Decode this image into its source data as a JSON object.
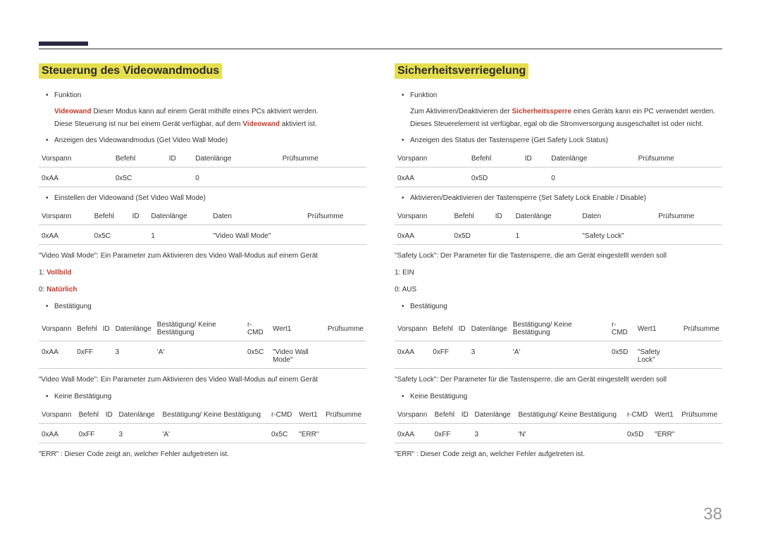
{
  "left": {
    "heading": "Steuerung des Videowandmodus",
    "bullet_funktion": "Funktion",
    "func_line1_pre": "Videowand",
    "func_line1_post": " Dieser Modus kann auf einem Gerät mithilfe eines PCs aktiviert werden.",
    "func_line2_pre": "Diese Steuerung ist nur bei einem Gerät verfügbar, auf dem ",
    "func_line2_red": "Videowand",
    "func_line2_post": " aktiviert ist.",
    "bullet_get": "Anzeigen des Videowandmodus (Get Video Wall Mode)",
    "hdr_vorspann": "Vorspann",
    "hdr_befehl": "Befehl",
    "hdr_id": "ID",
    "hdr_dlen": "Datenlänge",
    "hdr_daten": "Daten",
    "hdr_prufsumme": "Prüfsumme",
    "hdr_best": "Bestätigung/ Keine Bestätigung",
    "hdr_rcmd": "r-CMD",
    "hdr_wert1": "Wert1",
    "r_aa": "0xAA",
    "r_5c": "0x5C",
    "r_0": "0",
    "r_1": "1",
    "r_vwm": "\"Video Wall Mode\"",
    "bullet_set": "Einstellen der Videowand (Set Video Wall Mode)",
    "note_vwm": "\"Video Wall Mode\": Ein Parameter zum Aktivieren des Video Wall-Modus auf einem Gerät",
    "v1_pre": "1: ",
    "v1_red": "Vollbild",
    "v0_pre": "0: ",
    "v0_red": "Natürlich",
    "bullet_best": "Bestätigung",
    "r_ff": "0xFF",
    "r_3": "3",
    "r_a": "'A'",
    "r_n": "'N'",
    "r_vwm2": "\"Video Wall Mode\"",
    "bullet_nobest": "Keine Bestätigung",
    "r_err": "\"ERR\"",
    "note_err": "\"ERR\" : Dieser Code zeigt an, welcher Fehler aufgetreten ist."
  },
  "right": {
    "heading": "Sicherheitsverriegelung",
    "bullet_funktion": "Funktion",
    "func_line1_pre": "Zum Aktivieren/Deaktivieren der ",
    "func_line1_red": "Sicherheitssperre",
    "func_line1_post": " eines Geräts kann ein PC verwendet werden.",
    "func_line2": "Dieses Steuerelement ist verfügbar, egal ob die Stromversorgung ausgeschaltet ist oder nicht.",
    "bullet_get": "Anzeigen des Status der Tastensperre (Get Safety Lock Status)",
    "r_5d": "0x5D",
    "bullet_set": "Aktivieren/Deaktivieren der Tastensperre (Set Safety Lock Enable / Disable)",
    "r_slock": "\"Safety Lock\"",
    "note_slock": "\"Safety Lock\": Der Parameter für die Tastensperre, die am Gerät eingestellt werden soll",
    "v1": "1: EIN",
    "v0": "0: AUS",
    "bullet_best": "Bestätigung",
    "r_slock2": "\"Safety Lock\"",
    "bullet_nobest": "Keine Bestätigung"
  },
  "pagenum": "38"
}
